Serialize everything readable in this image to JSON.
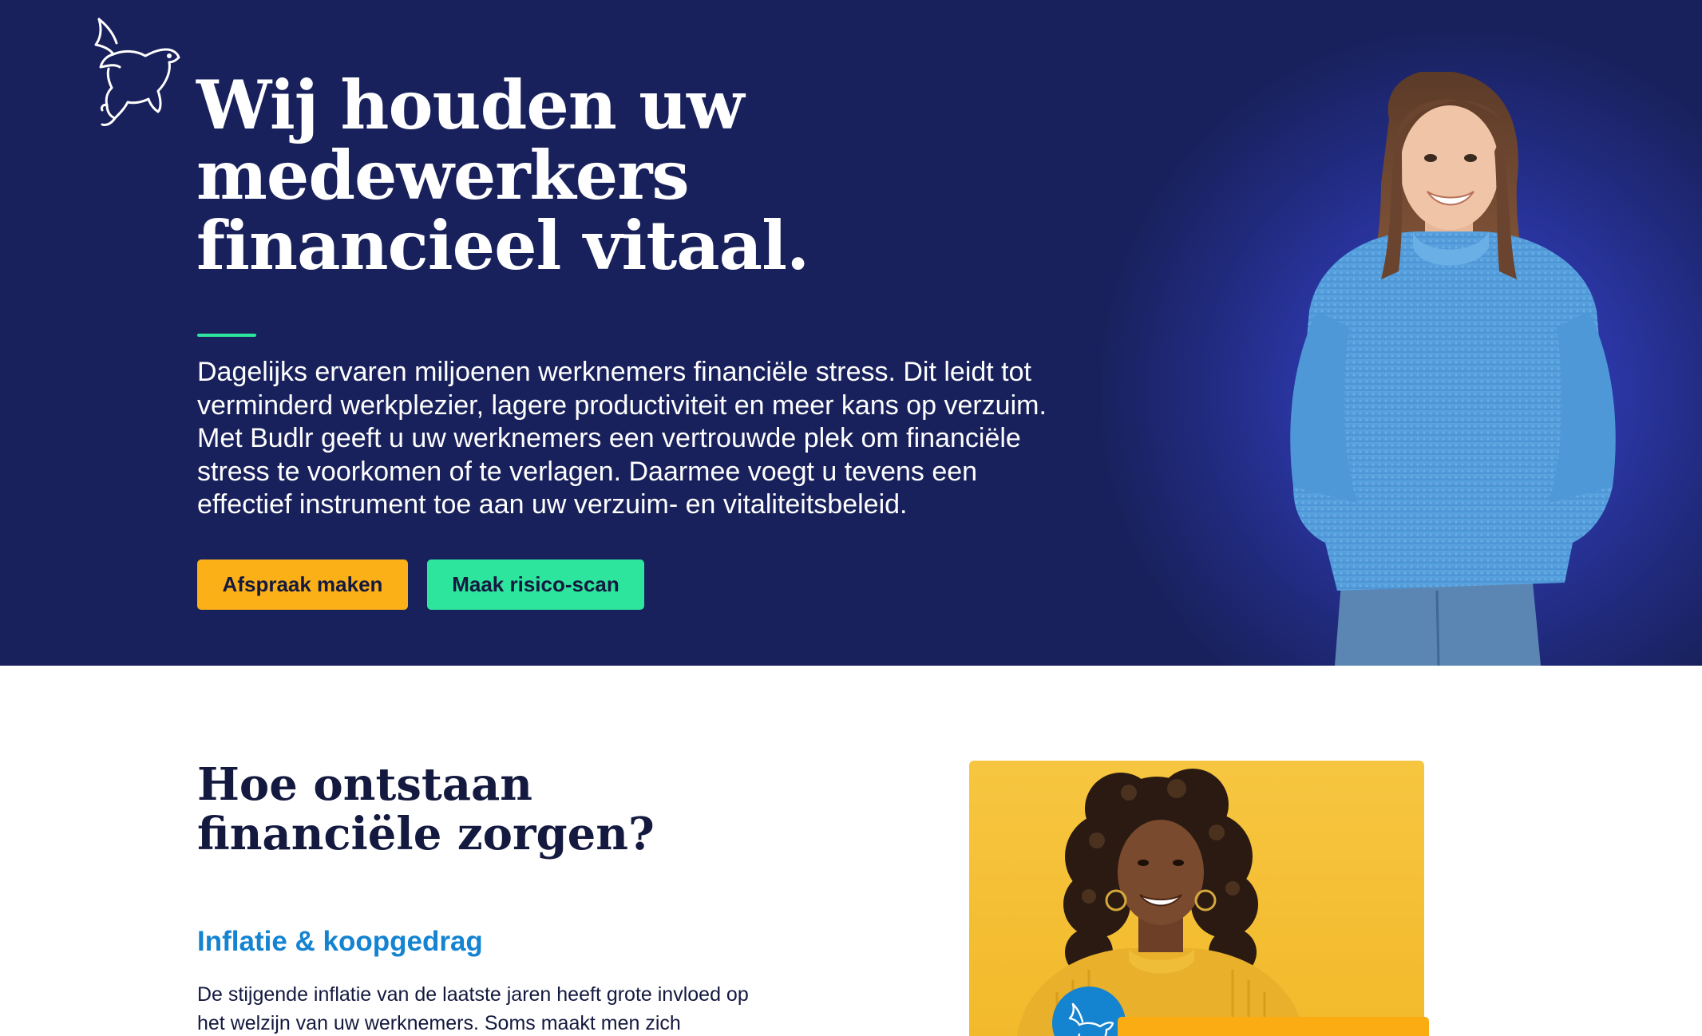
{
  "hero": {
    "title": "Wij houden uw medewerkers financieel vitaal.",
    "description": "Dagelijks ervaren miljoenen werknemers financiële stress. Dit leidt tot verminderd werkplezier, lagere productiviteit en meer kans op verzuim. Met Budlr geeft u uw werknemers een vertrouwde plek om financiële stress te voorkomen of te verlagen. Daarmee voegt u tevens een effectief instrument toe aan uw verzuim- en vitaliteitsbeleid.",
    "primary_button": "Afspraak maken",
    "secondary_button": "Maak risico-scan",
    "colors": {
      "background": "#19215c",
      "accent_green": "#2ee59d",
      "accent_orange": "#fbb017"
    },
    "logo_icon": "flying-pig-icon"
  },
  "section": {
    "title": "Hoe ontstaan financiële zorgen?",
    "subtitle": "Inflatie & koopgedrag",
    "text": "De stijgende inflatie van de laatste jaren heeft grote invloed op het welzijn van uw werknemers. Soms maakt men zich",
    "subtitle_color": "#1483d0",
    "card_color": "#f5bf35"
  }
}
